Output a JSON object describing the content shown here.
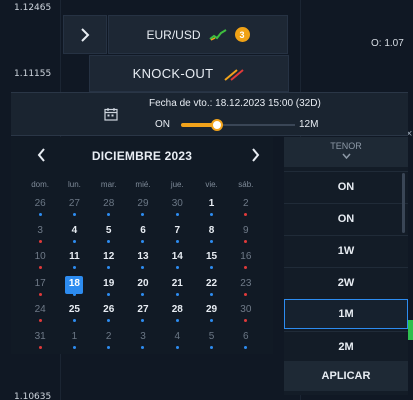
{
  "chart": {
    "price_top": "1.12465",
    "price_mid": "1.11155",
    "price_bottom": "1.10635",
    "o_label": "O: 1.07",
    "accent": "#f2a31b",
    "select_color": "#2d8cf0"
  },
  "asset": {
    "pair": "EUR/USD",
    "badge": "3",
    "icons": [
      "chevron-right-icon",
      "trend-chart-icon",
      "knockout-icon"
    ]
  },
  "product": {
    "label": "KNOCK-OUT"
  },
  "expiry": {
    "text": "Fecha de vto.: 18.12.2023 15:00 (32D)",
    "min_label": "ON",
    "max_label": "12M",
    "slider_fraction": 0.32
  },
  "calendar": {
    "month_title": "DICIEMBRE 2023",
    "weekdays": [
      "dom.",
      "lun.",
      "mar.",
      "mié.",
      "jue.",
      "vie.",
      "sáb."
    ],
    "weeks": [
      [
        "26",
        "27",
        "28",
        "29",
        "30",
        "1",
        "2"
      ],
      [
        "3",
        "4",
        "5",
        "6",
        "7",
        "8",
        "9"
      ],
      [
        "10",
        "11",
        "12",
        "13",
        "14",
        "15",
        "16"
      ],
      [
        "17",
        "18",
        "19",
        "20",
        "21",
        "22",
        "23"
      ],
      [
        "24",
        "25",
        "26",
        "27",
        "28",
        "29",
        "30"
      ],
      [
        "31",
        "1",
        "2",
        "3",
        "4",
        "5",
        "6"
      ]
    ],
    "selected_day": "18"
  },
  "tenor": {
    "header": "TENOR",
    "options": [
      "ON",
      "ON",
      "1W",
      "2W",
      "1M",
      "2M"
    ],
    "active": "1M",
    "apply_label": "APLICAR"
  }
}
